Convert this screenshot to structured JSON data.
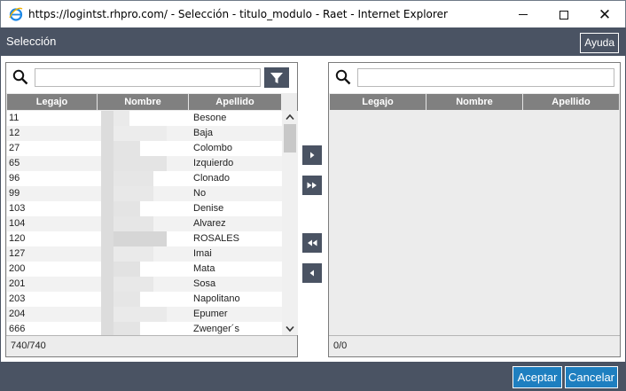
{
  "window": {
    "title": "https://logintst.rhpro.com/ - Selección - titulo_modulo - Raet - Internet Explorer",
    "minimize_glyph": "—",
    "maximize_glyph": "☐",
    "close_glyph": "✕"
  },
  "header": {
    "title": "Selección",
    "help_label": "Ayuda"
  },
  "left_panel": {
    "search_value": "",
    "columns": [
      "Legajo",
      "Nombre",
      "Apellido"
    ],
    "rows": [
      {
        "legajo": "11",
        "apellido": "Besone"
      },
      {
        "legajo": "12",
        "apellido": "Baja"
      },
      {
        "legajo": "27",
        "apellido": "Colombo"
      },
      {
        "legajo": "65",
        "apellido": "Izquierdo"
      },
      {
        "legajo": "96",
        "apellido": "Clonado"
      },
      {
        "legajo": "99",
        "apellido": "No"
      },
      {
        "legajo": "103",
        "apellido": "Denise"
      },
      {
        "legajo": "104",
        "apellido": "Alvarez"
      },
      {
        "legajo": "120",
        "apellido": "ROSALES"
      },
      {
        "legajo": "127",
        "apellido": "Imai"
      },
      {
        "legajo": "200",
        "apellido": "Mata"
      },
      {
        "legajo": "201",
        "apellido": "Sosa"
      },
      {
        "legajo": "203",
        "apellido": "Napolitano"
      },
      {
        "legajo": "204",
        "apellido": "Epumer"
      },
      {
        "legajo": "666",
        "apellido": "Zwenger´s"
      }
    ],
    "count": "740/740"
  },
  "right_panel": {
    "search_value": "",
    "columns": [
      "Legajo",
      "Nombre",
      "Apellido"
    ],
    "rows": [],
    "count": "0/0"
  },
  "footer": {
    "accept_label": "Aceptar",
    "cancel_label": "Cancelar"
  },
  "colors": {
    "header_bg": "#4a5363",
    "accent_blue": "#1e7fc0",
    "grid_header": "#808080"
  }
}
